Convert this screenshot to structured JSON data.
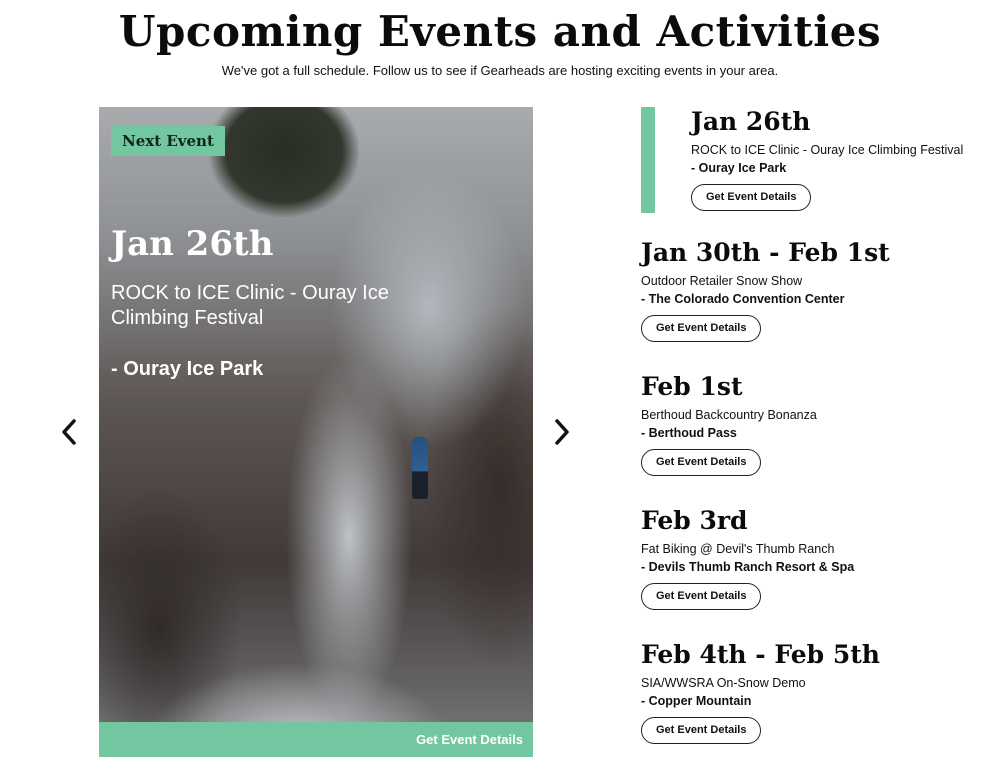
{
  "header": {
    "title": "Upcoming Events and Activities",
    "subtitle": "We've got a full schedule. Follow us to see if Gearheads are hosting exciting events in your area."
  },
  "featured": {
    "badge": "Next Event",
    "date": "Jan 26th",
    "title": "ROCK to ICE Clinic - Ouray Ice Climbing Festival",
    "venue": "- Ouray Ice Park",
    "cta": "Get Event Details"
  },
  "carousel": {
    "prev_icon": "chevron-left-icon",
    "next_icon": "chevron-right-icon"
  },
  "events": [
    {
      "date": "Jan 26th",
      "title": "ROCK to ICE Clinic - Ouray Ice Climbing Festival",
      "venue": "- Ouray Ice Park",
      "cta": "Get Event Details",
      "active": true
    },
    {
      "date": "Jan 30th - Feb 1st",
      "title": "Outdoor Retailer Snow Show",
      "venue": "- The Colorado Convention Center",
      "cta": "Get Event Details"
    },
    {
      "date": "Feb 1st",
      "title": "Berthoud Backcountry Bonanza",
      "venue": "- Berthoud Pass",
      "cta": "Get Event Details"
    },
    {
      "date": "Feb 3rd",
      "title": "Fat Biking @ Devil's Thumb Ranch",
      "venue": "- Devils Thumb Ranch Resort & Spa",
      "cta": "Get Event Details"
    },
    {
      "date": "Feb 4th - Feb 5th",
      "title": "SIA/WWSRA On-Snow Demo",
      "venue": "- Copper Mountain",
      "cta": "Get Event Details"
    }
  ],
  "colors": {
    "accent": "#72c6a0",
    "text": "#0b0b0b"
  }
}
